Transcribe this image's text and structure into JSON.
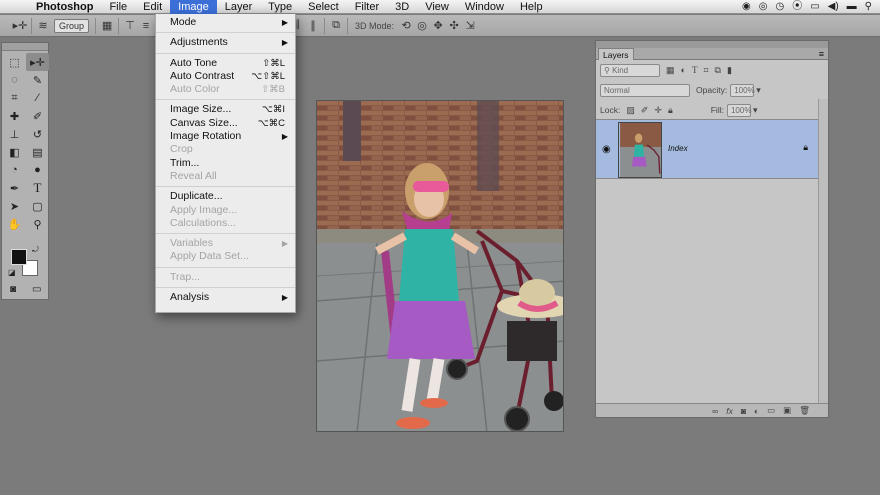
{
  "menubar": {
    "items": [
      "Photoshop",
      "File",
      "Edit",
      "Image",
      "Layer",
      "Type",
      "Select",
      "Filter",
      "3D",
      "View",
      "Window",
      "Help"
    ],
    "active": "Image"
  },
  "optionsbar": {
    "group_select": "Group",
    "mode3d_label": "3D Mode:"
  },
  "image_menu": {
    "items": [
      {
        "label": "Mode",
        "shortcut": "",
        "submenu": true,
        "disabled": false
      },
      {
        "sep": true
      },
      {
        "label": "Adjustments",
        "shortcut": "",
        "submenu": true,
        "disabled": false
      },
      {
        "sep": true
      },
      {
        "label": "Auto Tone",
        "shortcut": "⇧⌘L",
        "submenu": false,
        "disabled": false
      },
      {
        "label": "Auto Contrast",
        "shortcut": "⌥⇧⌘L",
        "submenu": false,
        "disabled": false
      },
      {
        "label": "Auto Color",
        "shortcut": "⇧⌘B",
        "submenu": false,
        "disabled": true
      },
      {
        "sep": true
      },
      {
        "label": "Image Size...",
        "shortcut": "⌥⌘I",
        "submenu": false,
        "disabled": false
      },
      {
        "label": "Canvas Size...",
        "shortcut": "⌥⌘C",
        "submenu": false,
        "disabled": false
      },
      {
        "label": "Image Rotation",
        "shortcut": "",
        "submenu": true,
        "disabled": false
      },
      {
        "label": "Crop",
        "shortcut": "",
        "submenu": false,
        "disabled": true
      },
      {
        "label": "Trim...",
        "shortcut": "",
        "submenu": false,
        "disabled": false
      },
      {
        "label": "Reveal All",
        "shortcut": "",
        "submenu": false,
        "disabled": true
      },
      {
        "sep": true
      },
      {
        "label": "Duplicate...",
        "shortcut": "",
        "submenu": false,
        "disabled": false
      },
      {
        "label": "Apply Image...",
        "shortcut": "",
        "submenu": false,
        "disabled": true
      },
      {
        "label": "Calculations...",
        "shortcut": "",
        "submenu": false,
        "disabled": true
      },
      {
        "sep": true
      },
      {
        "label": "Variables",
        "shortcut": "",
        "submenu": true,
        "disabled": true
      },
      {
        "label": "Apply Data Set...",
        "shortcut": "",
        "submenu": false,
        "disabled": true
      },
      {
        "sep": true
      },
      {
        "label": "Trap...",
        "shortcut": "",
        "submenu": false,
        "disabled": true
      },
      {
        "sep": true
      },
      {
        "label": "Analysis",
        "shortcut": "",
        "submenu": true,
        "disabled": false
      }
    ]
  },
  "layers_panel": {
    "tab_label": "Layers",
    "filter_kind": "Kind",
    "blend_mode": "Normal",
    "opacity_label": "Opacity:",
    "opacity_value": "100%",
    "lock_label": "Lock:",
    "fill_label": "Fill:",
    "fill_value": "100%",
    "layer_name": "Index"
  },
  "colors": {
    "menu_highlight": "#3c6fd8",
    "layer_selected": "#a5badf",
    "workspace": "#7b7b7b"
  }
}
